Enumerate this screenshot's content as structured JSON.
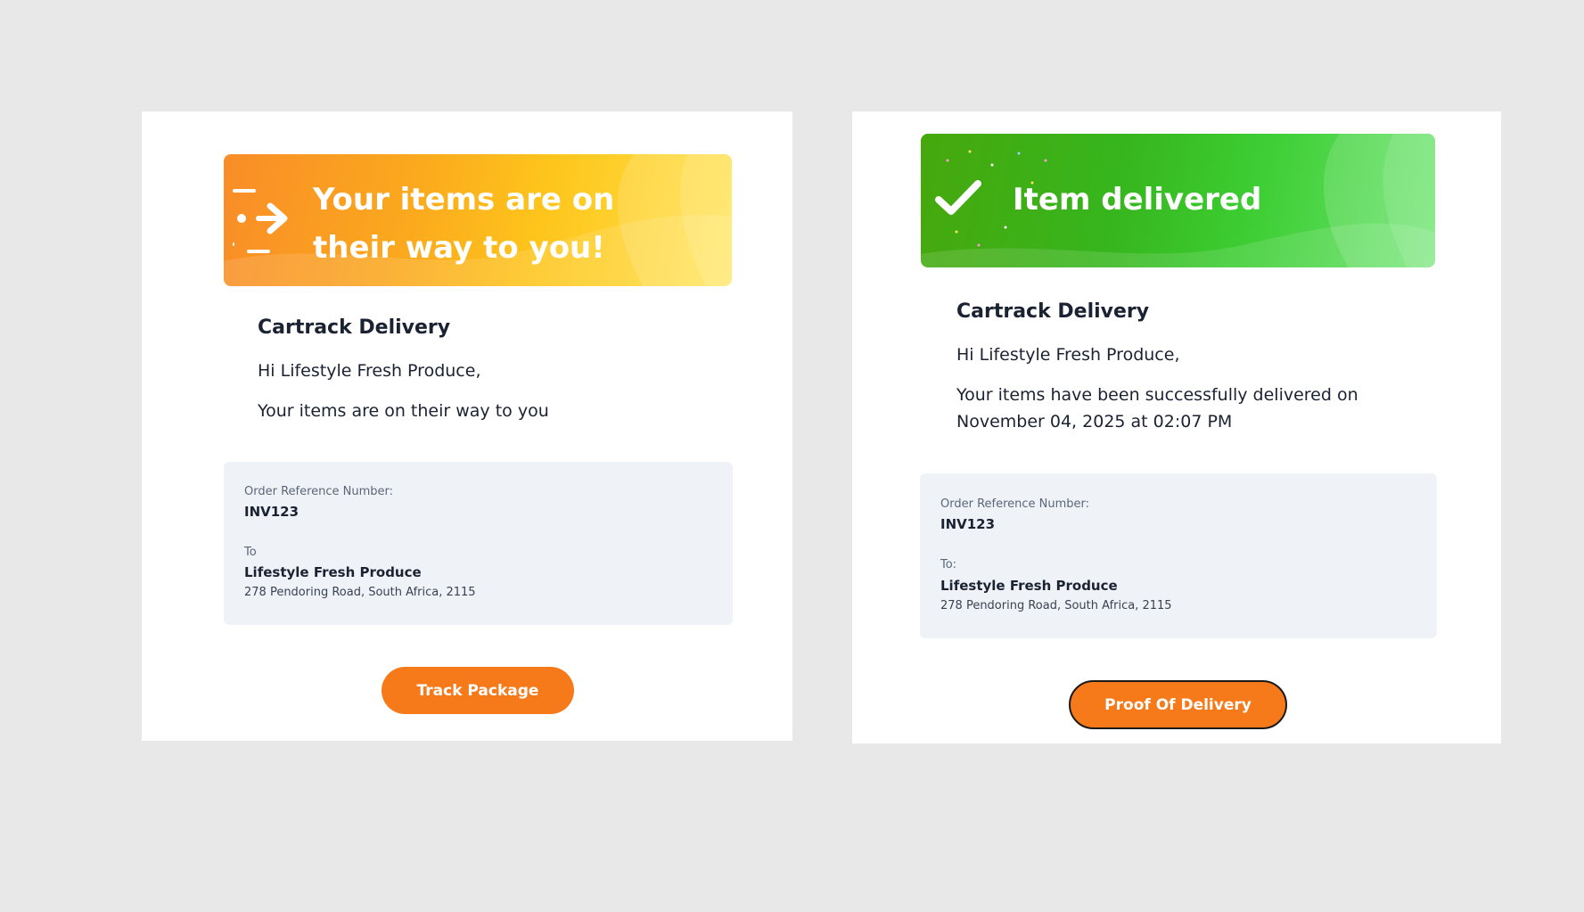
{
  "cards": {
    "in_transit": {
      "banner_title": "Your items are on their way to you!",
      "banner_icon": "delivery-arrow-icon",
      "company": "Cartrack Delivery",
      "greeting": "Hi Lifestyle Fresh Produce,",
      "message": "Your items are on their way to you",
      "order_ref_label": "Order Reference Number:",
      "order_ref_value": "INV123",
      "to_label": "To",
      "to_name": "Lifestyle Fresh Produce",
      "to_address": "278 Pendoring Road, South Africa, 2115",
      "button_label": "Track Package"
    },
    "delivered": {
      "banner_title": "Item delivered",
      "banner_icon": "checkmark-icon",
      "company": "Cartrack Delivery",
      "greeting": "Hi Lifestyle Fresh Produce,",
      "message": "Your items have been successfully delivered on November 04, 2025 at 02:07 PM",
      "order_ref_label": "Order Reference Number:",
      "order_ref_value": "INV123",
      "to_label": "To:",
      "to_name": "Lifestyle Fresh Produce",
      "to_address": "278 Pendoring Road, South Africa, 2115",
      "button_label": "Proof Of Delivery"
    }
  },
  "colors": {
    "page_background": "#e8e8e8",
    "accent_orange": "#f67a1a",
    "banner_orange_start": "#f98d28",
    "banner_orange_end": "#ffe34a",
    "banner_green_start": "#46a80d",
    "banner_green_end": "#67e46a",
    "info_box_background": "#eff3f8"
  }
}
